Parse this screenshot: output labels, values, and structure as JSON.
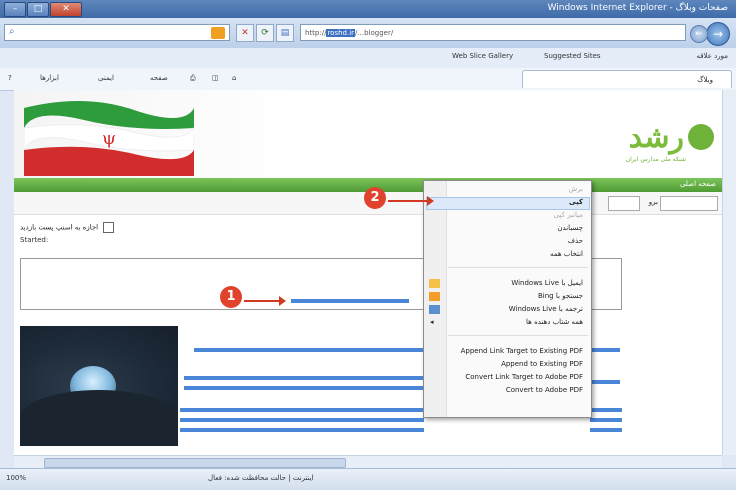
{
  "window": {
    "title": "صفحات وبلاگ - Windows Internet Explorer",
    "minimize": "–",
    "maximize": "□",
    "close": "✕"
  },
  "address": {
    "url": "http://",
    "url_highlight": "roshd.ir",
    "url_rest": "/...blogger/"
  },
  "favorites": {
    "label": "مورد علاقه",
    "web_slice": "Web Slice Gallery",
    "suggested": "Suggested Sites",
    "tab_title": "وبلاگ"
  },
  "commands": {
    "tools": "ابزارها",
    "safety": "ایمنی",
    "page": "صفحه"
  },
  "site": {
    "logo": "رشد",
    "logo_sub": "شبکه ملی مدارس ایران",
    "greenbar_right": "صفحه اصلی",
    "greenbar_left": "",
    "search_go": "برو"
  },
  "post": {
    "checkbox_label": "اجازه به اسنپ پست بازدید",
    "date": "Started:"
  },
  "context_menu": {
    "items": [
      {
        "label": "برش",
        "disabled": true
      },
      {
        "label": "کپی",
        "disabled": false,
        "highlight": true
      },
      {
        "label": "میانبر کپی",
        "disabled": true
      },
      {
        "label": "چسباندن",
        "disabled": false
      },
      {
        "label": "حذف",
        "disabled": false
      },
      {
        "label": "انتخاب همه",
        "disabled": false
      },
      {
        "label": "ایمیل با Windows Live",
        "disabled": false
      },
      {
        "label": "جستجو با Bing",
        "disabled": false
      },
      {
        "label": "ترجمه با Windows Live",
        "disabled": false
      },
      {
        "label": "همه شتاب دهنده ها",
        "disabled": false
      },
      {
        "label": "Append Link Target to Existing PDF",
        "disabled": false,
        "ltr": true
      },
      {
        "label": "Append to Existing PDF",
        "disabled": false,
        "ltr": true
      },
      {
        "label": "Convert Link Target to Adobe PDF",
        "disabled": false,
        "ltr": true
      },
      {
        "label": "Convert to Adobe PDF",
        "disabled": false,
        "ltr": true
      }
    ]
  },
  "callouts": {
    "one": "1",
    "two": "2"
  },
  "status": {
    "text": "اینترنت | حالت محافظت شده: فعال",
    "zone": "اینترنت",
    "zoom": "100%"
  }
}
